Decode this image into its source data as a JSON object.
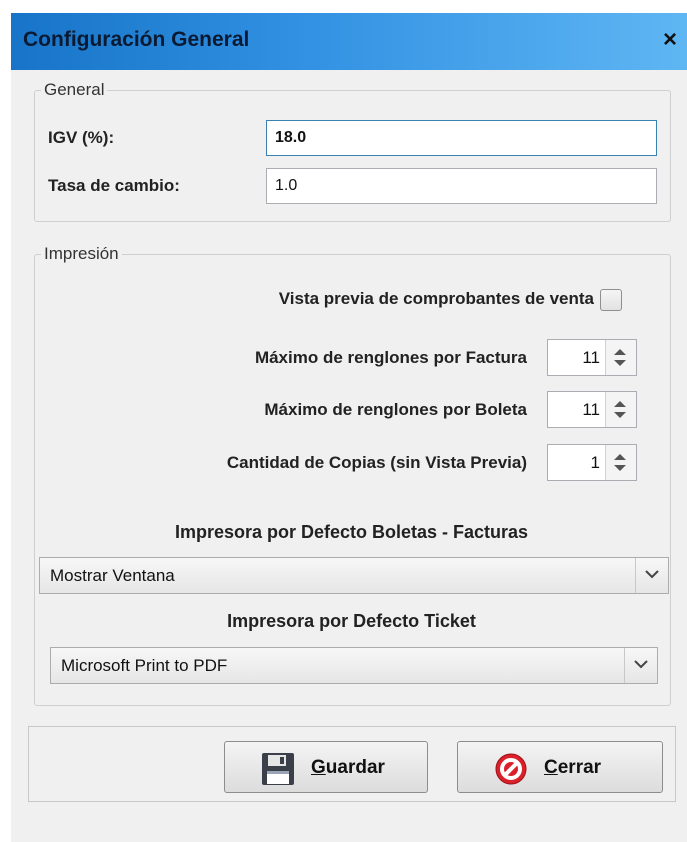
{
  "window": {
    "title": "Configuración General",
    "close_glyph": "×"
  },
  "general": {
    "legend": "General",
    "igv_label": "IGV (%):",
    "igv_value": "18.0",
    "tasa_label": "Tasa de cambio:",
    "tasa_value": "1.0"
  },
  "impresion": {
    "legend": "Impresión",
    "vista_previa_label": "Vista previa de comprobantes de venta",
    "vista_previa_checked": false,
    "max_factura_label": "Máximo de renglones por Factura",
    "max_factura_value": "11",
    "max_boleta_label": "Máximo de renglones por Boleta",
    "max_boleta_value": "11",
    "copias_label": "Cantidad de Copias (sin Vista Previa)",
    "copias_value": "1",
    "impresora_bf_label": "Impresora por Defecto Boletas - Facturas",
    "impresora_bf_value": "Mostrar Ventana",
    "impresora_ticket_label": "Impresora por Defecto Ticket",
    "impresora_ticket_value": "Microsoft Print to PDF"
  },
  "buttons": {
    "guardar": {
      "mnemonic": "G",
      "rest": "uardar",
      "icon": "floppy-disk-icon"
    },
    "cerrar": {
      "mnemonic": "C",
      "rest": "errar",
      "icon": "cancel-icon"
    }
  },
  "colors": {
    "titlebar_start": "#1774c8",
    "titlebar_end": "#5fb6f3",
    "dialog_bg": "#f0f0f0"
  }
}
